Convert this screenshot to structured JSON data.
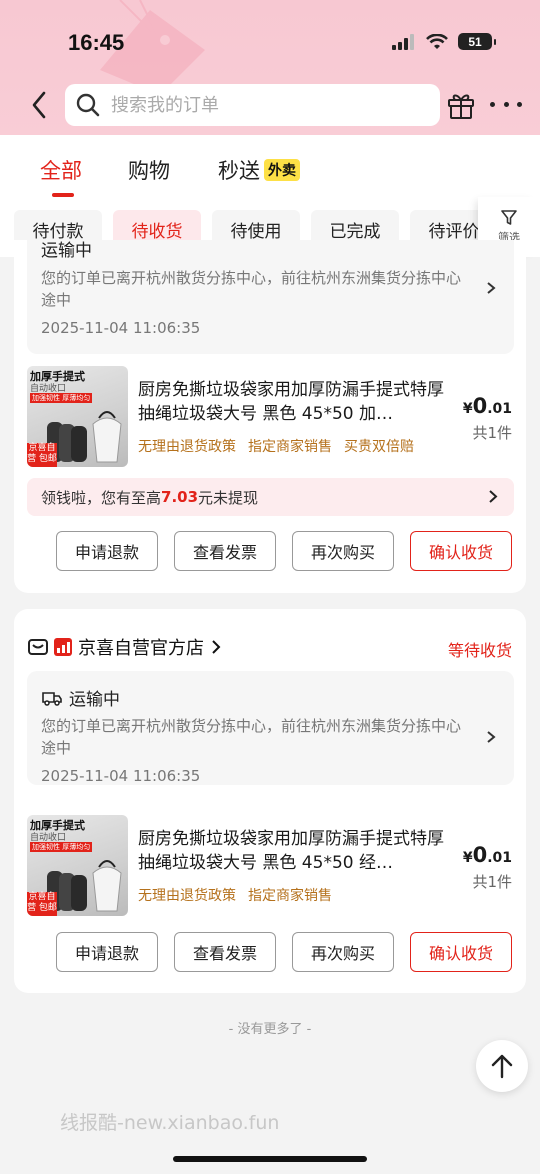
{
  "status_bar": {
    "time": "16:45",
    "battery": "51"
  },
  "search": {
    "placeholder": "搜索我的订单"
  },
  "main_tabs": [
    {
      "label": "全部",
      "active": true
    },
    {
      "label": "购物",
      "active": false
    },
    {
      "label": "秒送",
      "badge": "外卖",
      "active": false
    }
  ],
  "status_tabs": [
    {
      "label": "待付款",
      "active": false
    },
    {
      "label": "待收货",
      "active": true
    },
    {
      "label": "待使用",
      "active": false
    },
    {
      "label": "已完成",
      "active": false
    },
    {
      "label": "待评价",
      "active": false
    }
  ],
  "filter_label": "筛选",
  "orders": [
    {
      "shipping": {
        "title": "运输中",
        "desc": "您的订单已离开杭州散货分拣中心，前往杭州东洲集货分拣中心途中",
        "time": "2025-11-04 11:06:35"
      },
      "product": {
        "image_title": "加厚手提式",
        "image_sub": "自动收口",
        "image_note": "加强韧性 厚薄均匀",
        "image_tag": "京喜自营 包邮",
        "name": "厨房免撕垃圾袋家用加厚防漏手提式特厚抽绳垃圾袋大号 黑色 45*50 加…",
        "price_symbol": "¥",
        "price_int": "0",
        "price_dec": ".01",
        "qty": "共1件",
        "tags": [
          "无理由退货政策",
          "指定商家销售",
          "买贵双倍赔"
        ]
      },
      "promo": {
        "prefix": "领钱啦，您有至高",
        "amount": "7.03",
        "suffix": "元未提现"
      },
      "buttons": [
        "申请退款",
        "查看发票",
        "再次购买",
        "确认收货"
      ]
    },
    {
      "store": "京喜自营官方店",
      "status": "等待收货",
      "shipping": {
        "title": "运输中",
        "desc": "您的订单已离开杭州散货分拣中心，前往杭州东洲集货分拣中心途中",
        "time": "2025-11-04 11:06:35"
      },
      "product": {
        "image_title": "加厚手提式",
        "image_sub": "自动收口",
        "image_note": "加强韧性 厚薄均匀",
        "image_tag": "京喜自营 包邮",
        "name": "厨房免撕垃圾袋家用加厚防漏手提式特厚抽绳垃圾袋大号 黑色 45*50 经…",
        "price_symbol": "¥",
        "price_int": "0",
        "price_dec": ".01",
        "qty": "共1件",
        "tags": [
          "无理由退货政策",
          "指定商家销售"
        ]
      },
      "buttons": [
        "申请退款",
        "查看发票",
        "再次购买",
        "确认收货"
      ]
    }
  ],
  "no_more": "- 没有更多了 -",
  "watermark": "线报酷-new.xianbao.fun",
  "colors": {
    "accent": "#e2231a",
    "header_bg": "#f9cdd6",
    "tag_gold": "#b5711c"
  }
}
